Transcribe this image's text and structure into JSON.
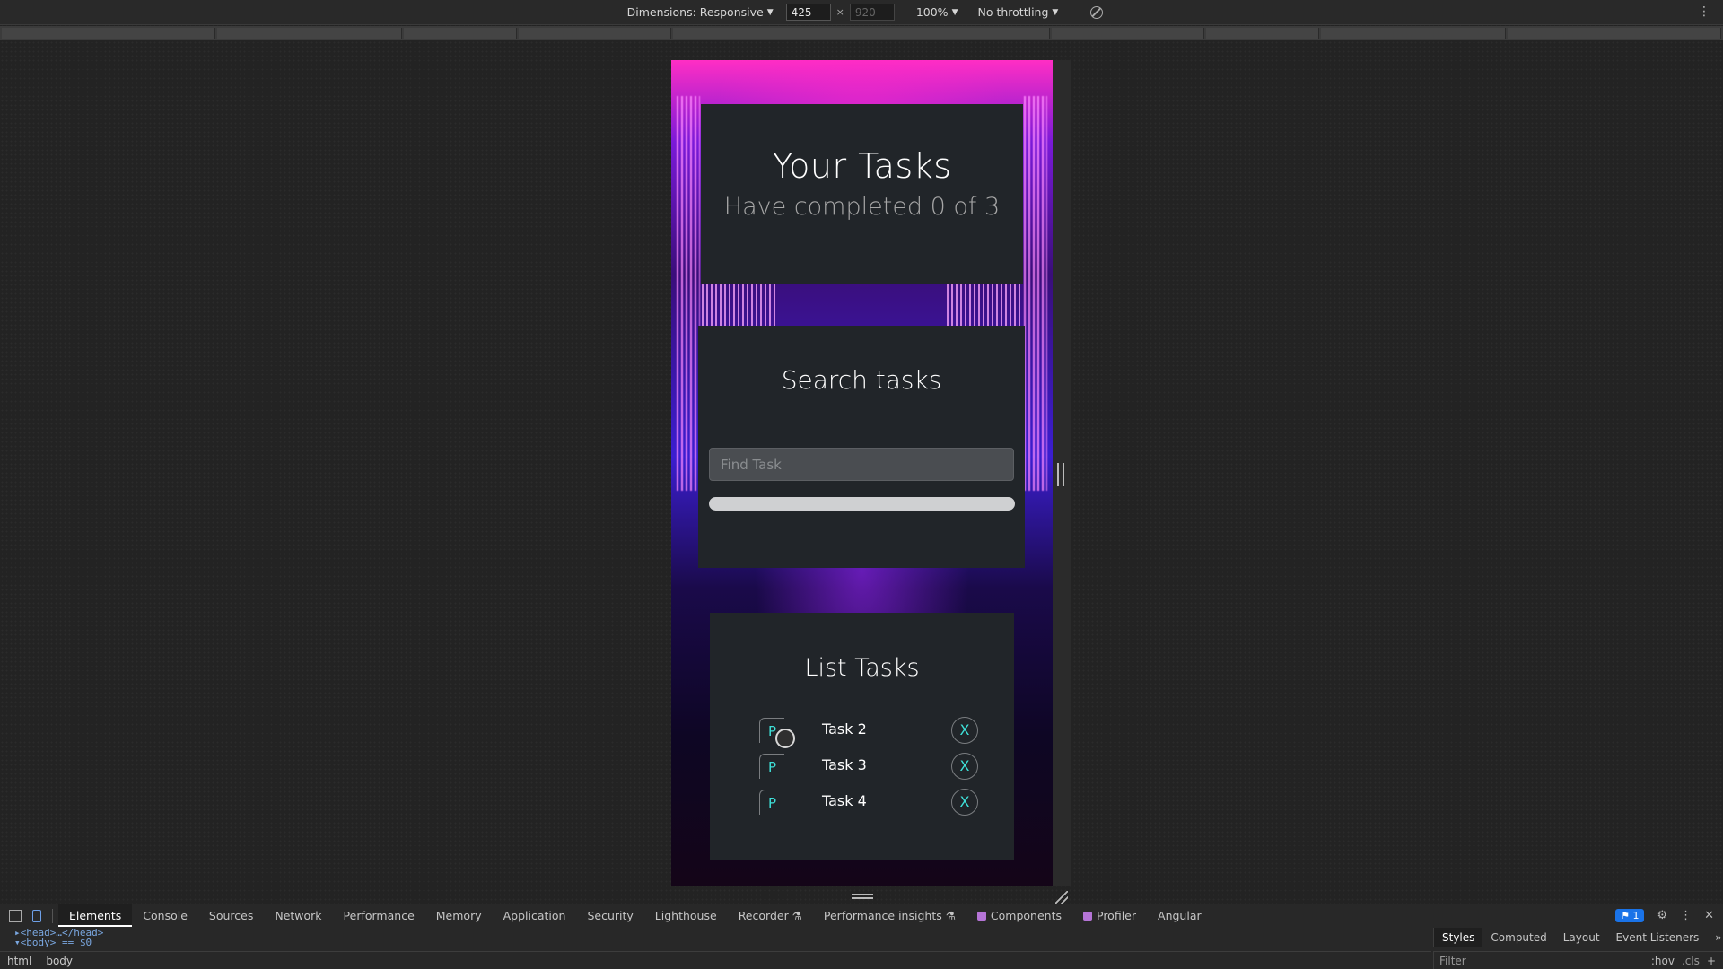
{
  "device_toolbar": {
    "dimensions_label": "Dimensions: Responsive",
    "width_value": "425",
    "height_value": "920",
    "times": "×",
    "zoom": "100%",
    "throttling": "No throttling"
  },
  "app": {
    "header": {
      "title": "Your Tasks",
      "subtitle": "Have completed 0 of 3"
    },
    "search": {
      "title": "Search tasks",
      "placeholder": "Find Task"
    },
    "list": {
      "title": "List Tasks",
      "tasks": [
        {
          "priority": "P",
          "name": "Task 2",
          "delete": "X"
        },
        {
          "priority": "P",
          "name": "Task 3",
          "delete": "X"
        },
        {
          "priority": "P",
          "name": "Task 4",
          "delete": "X"
        }
      ]
    }
  },
  "devtools": {
    "tabs": [
      "Elements",
      "Console",
      "Sources",
      "Network",
      "Performance",
      "Memory",
      "Application",
      "Security",
      "Lighthouse",
      "Recorder ⚗",
      "Performance insights ⚗",
      "Components",
      "Profiler",
      "Angular"
    ],
    "issues_count": "1",
    "code_lines": [
      "▸<head>…</head>",
      "▾<body> == $0"
    ],
    "breadcrumb": [
      "html",
      "body"
    ],
    "styles_tabs": [
      "Styles",
      "Computed",
      "Layout",
      "Event Listeners"
    ],
    "filter_placeholder": "Filter",
    "hov": ":hov",
    "cls": ".cls"
  }
}
